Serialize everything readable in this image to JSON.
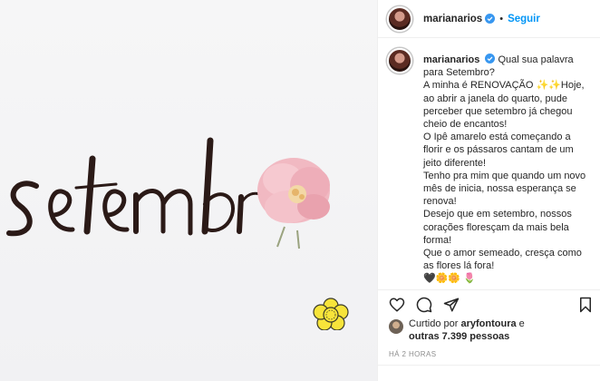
{
  "post": {
    "username": "marianarios",
    "follow_label": "Seguir",
    "separator": "•",
    "caption_lines": [
      "Qual sua palavra para Setembro?",
      "A minha é RENOVAÇÃO ✨✨Hoje, ao abrir a janela do quarto, pude perceber que setembro já chegou cheio de encantos!",
      "O Ipê amarelo está começando a florir e os pássaros cantam de um jeito diferente!",
      "Tenho pra mim que quando um novo mês de inicia, nossa esperança se renova!",
      "Desejo que em setembro, nossos corações floresçam da mais bela forma!",
      "Que o amor semeado, cresça como as flores lá fora!",
      "🖤🌼🌼 🌷"
    ],
    "liked_prefix": "Curtido por",
    "liked_user": "aryfontoura",
    "liked_and": "e",
    "liked_others": "outras 7.399 pessoas",
    "time_ago": "HÁ 2 HORAS"
  },
  "image": {
    "script_word": "setembr",
    "sticker_color": "#f7e43a"
  },
  "icons": {
    "verified": "verified-badge-icon",
    "like": "heart-icon",
    "comment": "comment-icon",
    "share": "paper-plane-icon",
    "save": "bookmark-icon"
  },
  "colors": {
    "accent": "#0095f6",
    "text": "#262626",
    "muted": "#8e8e8e"
  }
}
